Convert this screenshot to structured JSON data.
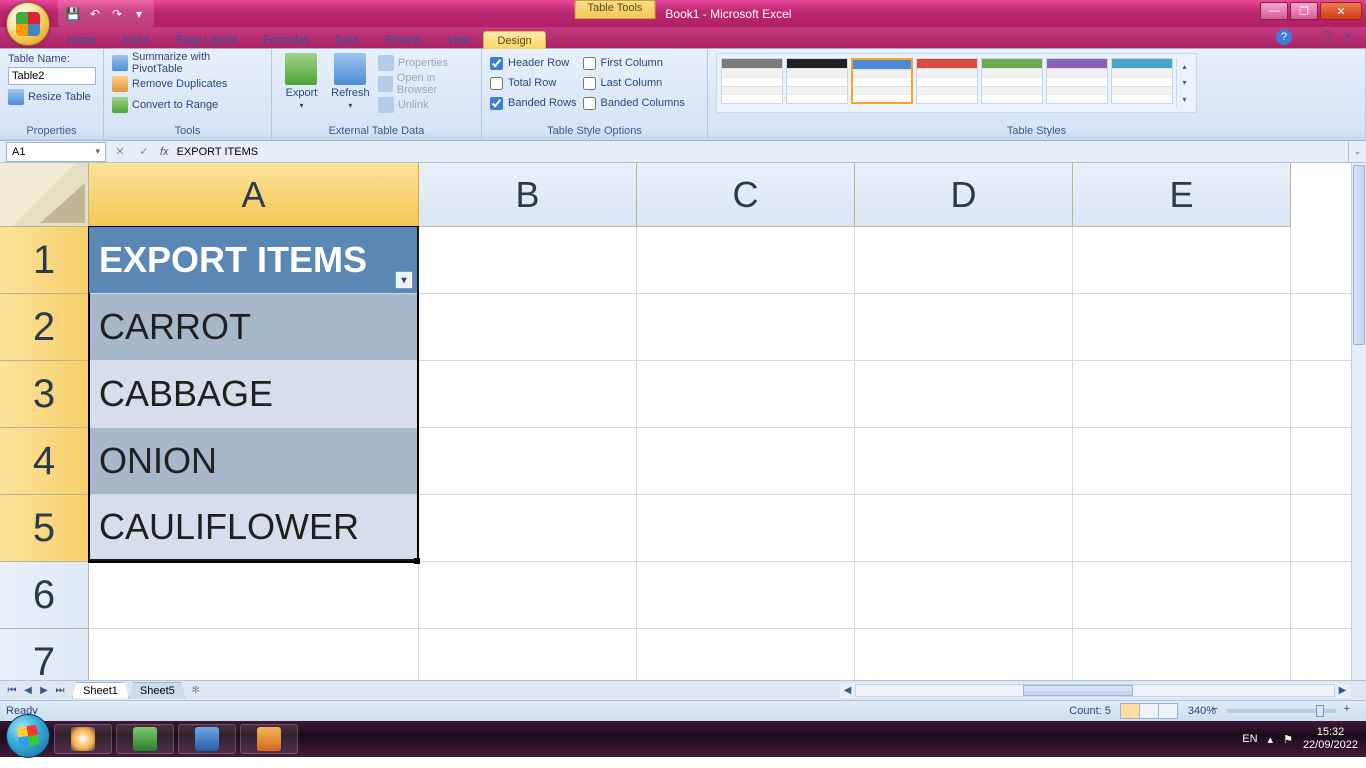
{
  "titlebar": {
    "table_tools": "Table Tools",
    "title": "Book1 - Microsoft Excel"
  },
  "tabs": {
    "home": "Home",
    "insert": "Insert",
    "page_layout": "Page Layout",
    "formulas": "Formulas",
    "data": "Data",
    "review": "Review",
    "view": "View",
    "design": "Design"
  },
  "ribbon": {
    "properties": {
      "title": "Properties",
      "name_label": "Table Name:",
      "name_value": "Table2",
      "resize": "Resize Table"
    },
    "tools": {
      "title": "Tools",
      "pivot": "Summarize with PivotTable",
      "dup": "Remove Duplicates",
      "range": "Convert to Range"
    },
    "external": {
      "title": "External Table Data",
      "export": "Export",
      "refresh": "Refresh",
      "props": "Properties",
      "browser": "Open in Browser",
      "unlink": "Unlink"
    },
    "style_options": {
      "title": "Table Style Options",
      "header_row": "Header Row",
      "total_row": "Total Row",
      "banded_rows": "Banded Rows",
      "first_col": "First Column",
      "last_col": "Last Column",
      "banded_cols": "Banded Columns"
    },
    "styles": {
      "title": "Table Styles"
    }
  },
  "style_colors": [
    "#7a7a7a",
    "#222222",
    "#4e8bd6",
    "#d94a3f",
    "#6fa84f",
    "#8a63b8",
    "#49a6c9"
  ],
  "formulabar": {
    "namebox": "A1",
    "formula": "EXPORT ITEMS"
  },
  "grid": {
    "columns": [
      "A",
      "B",
      "C",
      "D",
      "E"
    ],
    "rows": [
      "1",
      "2",
      "3",
      "4",
      "5",
      "6",
      "7"
    ],
    "table_header": "EXPORT ITEMS",
    "table_data": [
      "CARROT",
      "CABBAGE",
      "ONION",
      "CAULIFLOWER"
    ]
  },
  "sheets": {
    "s1": "Sheet1",
    "s2": "Sheet5"
  },
  "statusbar": {
    "ready": "Ready",
    "count": "Count: 5",
    "zoom": "340%"
  },
  "tray": {
    "lang": "EN",
    "time": "15:32",
    "date": "22/09/2022"
  }
}
